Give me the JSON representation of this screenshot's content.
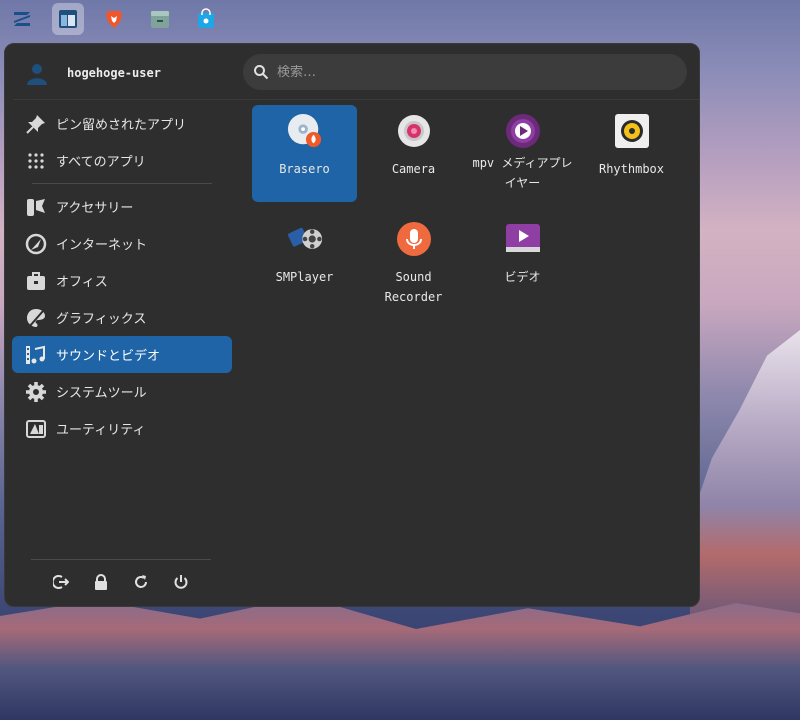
{
  "topbar": {
    "items": [
      {
        "icon": "zorin-logo-icon",
        "active": false
      },
      {
        "icon": "window-layout-icon",
        "active": true
      },
      {
        "icon": "brave-browser-icon",
        "active": false
      },
      {
        "icon": "file-cabinet-icon",
        "active": false
      },
      {
        "icon": "software-store-icon",
        "active": false
      }
    ]
  },
  "menu": {
    "user": {
      "name": "hogehoge-user",
      "icon": "user-avatar-icon"
    },
    "search": {
      "placeholder": "検索…",
      "icon": "search-icon"
    },
    "categories": [
      {
        "label": "ピン留めされたアプリ",
        "icon": "pin-icon"
      },
      {
        "label": "すべてのアプリ",
        "icon": "app-grid-icon"
      },
      {
        "label": "アクセサリー",
        "icon": "accessories-icon"
      },
      {
        "label": "インターネット",
        "icon": "internet-icon"
      },
      {
        "label": "オフィス",
        "icon": "office-briefcase-icon"
      },
      {
        "label": "グラフィックス",
        "icon": "graphics-palette-icon"
      },
      {
        "label": "サウンドとビデオ",
        "icon": "sound-video-icon",
        "selected": true
      },
      {
        "label": "システムツール",
        "icon": "gear-icon"
      },
      {
        "label": "ユーティリティ",
        "icon": "utilities-icon"
      }
    ],
    "apps": [
      {
        "label": "Brasero",
        "icon": "brasero-disc-icon",
        "selected": true
      },
      {
        "label": "Camera",
        "icon": "camera-icon"
      },
      {
        "label": "mpv メディアプレイヤー",
        "icon": "mpv-icon"
      },
      {
        "label": "Rhythmbox",
        "icon": "rhythmbox-icon"
      },
      {
        "label": "SMPlayer",
        "icon": "smplayer-icon"
      },
      {
        "label": "Sound Recorder",
        "icon": "microphone-icon"
      },
      {
        "label": "ビデオ",
        "icon": "video-play-icon"
      }
    ],
    "actions": [
      {
        "icon": "logout-icon"
      },
      {
        "icon": "lock-icon"
      },
      {
        "icon": "restart-icon"
      },
      {
        "icon": "power-icon"
      }
    ],
    "colors": {
      "accent": "#1f64a6",
      "menu_bg": "#2e2e2e"
    }
  }
}
